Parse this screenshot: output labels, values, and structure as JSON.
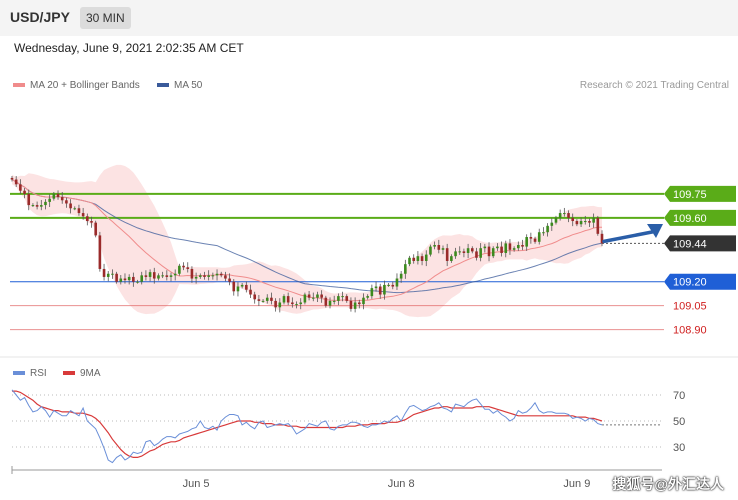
{
  "header": {
    "symbol": "USD/JPY",
    "timeframe": "30 MIN"
  },
  "datetime": "Wednesday, June 9, 2021 2:02:35 AM CET",
  "legend": {
    "ma20": "MA 20 + Bollinger Bands",
    "ma50": "MA 50"
  },
  "credit": "Research © 2021 Trading Central",
  "rsi_legend": {
    "rsi": "RSI",
    "ma9": "9MA"
  },
  "watermark": "搜狐号@外汇达人",
  "colors": {
    "ma20": "#f08c8c",
    "ma50": "#3a5a9a",
    "bands": "#fce0e0",
    "green": "#5aac18",
    "blue": "#1f5fd6",
    "red": "#e06060",
    "current": "#333333",
    "rsi": "#6a8fd8",
    "rsi_ma": "#d83a3a"
  },
  "chart_data": [
    {
      "type": "candlestick",
      "y_range": [
        108.76,
        110.1
      ],
      "x_labels": [
        {
          "label": "Jun 5",
          "index": 44
        },
        {
          "label": "Jun 8",
          "index": 93
        },
        {
          "label": "Jun 9",
          "index": 135
        }
      ],
      "close": [
        109.84,
        109.81,
        109.77,
        109.75,
        109.68,
        109.68,
        109.67,
        109.68,
        109.7,
        109.72,
        109.75,
        109.73,
        109.71,
        109.69,
        109.66,
        109.66,
        109.63,
        109.61,
        109.58,
        109.57,
        109.49,
        109.28,
        109.23,
        109.25,
        109.25,
        109.2,
        109.22,
        109.21,
        109.23,
        109.2,
        109.2,
        109.24,
        109.23,
        109.26,
        109.22,
        109.24,
        109.24,
        109.23,
        109.24,
        109.25,
        109.3,
        109.29,
        109.28,
        109.22,
        109.23,
        109.24,
        109.23,
        109.24,
        109.24,
        109.25,
        109.24,
        109.22,
        109.2,
        109.14,
        109.17,
        109.18,
        109.15,
        109.12,
        109.09,
        109.08,
        109.08,
        109.1,
        109.08,
        109.04,
        109.07,
        109.11,
        109.07,
        109.06,
        109.06,
        109.07,
        109.12,
        109.1,
        109.1,
        109.12,
        109.1,
        109.05,
        109.08,
        109.08,
        109.11,
        109.11,
        109.08,
        109.03,
        109.07,
        109.06,
        109.1,
        109.11,
        109.16,
        109.17,
        109.12,
        109.18,
        109.18,
        109.17,
        109.22,
        109.25,
        109.31,
        109.35,
        109.33,
        109.36,
        109.33,
        109.37,
        109.42,
        109.43,
        109.4,
        109.41,
        109.33,
        109.36,
        109.39,
        109.39,
        109.38,
        109.41,
        109.39,
        109.35,
        109.41,
        109.42,
        109.36,
        109.41,
        109.42,
        109.38,
        109.44,
        109.4,
        109.41,
        109.43,
        109.42,
        109.48,
        109.47,
        109.45,
        109.51,
        109.51,
        109.55,
        109.57,
        109.6,
        109.63,
        109.63,
        109.6,
        109.58,
        109.56,
        109.58,
        109.58,
        109.57,
        109.6,
        109.5,
        109.44
      ],
      "levels": [
        {
          "value": 109.75,
          "label": "109.75",
          "kind": "resistance"
        },
        {
          "value": 109.6,
          "label": "109.60",
          "kind": "resistance"
        },
        {
          "value": 109.44,
          "label": "109.44",
          "kind": "current"
        },
        {
          "value": 109.2,
          "label": "109.20",
          "kind": "pivot"
        },
        {
          "value": 109.05,
          "label": "109.05",
          "kind": "support"
        },
        {
          "value": 108.9,
          "label": "108.90",
          "kind": "support"
        }
      ]
    },
    {
      "type": "line",
      "y_range": [
        20,
        80
      ],
      "y_ticks": [
        70,
        50,
        30
      ],
      "rsi": [
        74,
        70,
        66,
        68,
        62,
        57,
        58,
        61,
        58,
        53,
        58,
        56,
        54,
        54,
        58,
        56,
        54,
        60,
        50,
        47,
        44,
        37,
        29,
        20,
        18,
        22,
        24,
        20,
        22,
        26,
        25,
        26,
        34,
        35,
        31,
        33,
        36,
        38,
        38,
        37,
        40,
        41,
        42,
        44,
        45,
        50,
        45,
        44,
        46,
        43,
        50,
        53,
        55,
        55,
        54,
        47,
        49,
        46,
        44,
        49,
        50,
        45,
        46,
        47,
        48,
        47,
        48,
        45,
        40,
        42,
        44,
        48,
        47,
        46,
        49,
        50,
        44,
        43,
        46,
        47,
        47,
        49,
        49,
        48,
        46,
        45,
        47,
        47,
        48,
        50,
        49,
        52,
        54,
        50,
        56,
        61,
        62,
        60,
        58,
        59,
        61,
        62,
        64,
        60,
        59,
        57,
        63,
        62,
        61,
        64,
        66,
        67,
        63,
        59,
        59,
        56,
        58,
        55,
        53,
        50,
        52,
        58,
        56,
        57,
        60,
        64,
        58,
        56,
        57,
        57,
        56,
        56,
        56,
        55,
        52,
        53,
        52,
        50,
        52,
        51,
        48,
        47
      ],
      "ma9": [
        73,
        73,
        72,
        70,
        68,
        66,
        63,
        61,
        60,
        59,
        58,
        58,
        57,
        57,
        57,
        56,
        56,
        56,
        55,
        54,
        52,
        49,
        45,
        41,
        36,
        32,
        28,
        25,
        23,
        22,
        22,
        23,
        25,
        27,
        28,
        30,
        32,
        33,
        34,
        34,
        35,
        37,
        38,
        39,
        40,
        41,
        42,
        43,
        44,
        45,
        46,
        47,
        48,
        49,
        50,
        50,
        50,
        50,
        49,
        49,
        48,
        48,
        48,
        47,
        47,
        47,
        46,
        46,
        46,
        45,
        45,
        45,
        45,
        45,
        45,
        45,
        45,
        45,
        45,
        45,
        46,
        46,
        46,
        47,
        47,
        47,
        48,
        48,
        48,
        48,
        49,
        49,
        49,
        50,
        51,
        53,
        55,
        56,
        57,
        58,
        59,
        60,
        60,
        61,
        61,
        60,
        60,
        60,
        60,
        60,
        60,
        61,
        61,
        61,
        61,
        60,
        59,
        58,
        57,
        56,
        55,
        54,
        54,
        54,
        54,
        54,
        54,
        54,
        54,
        54,
        54,
        54,
        54,
        54,
        54,
        53,
        53,
        53,
        52,
        52,
        51,
        50
      ]
    }
  ]
}
